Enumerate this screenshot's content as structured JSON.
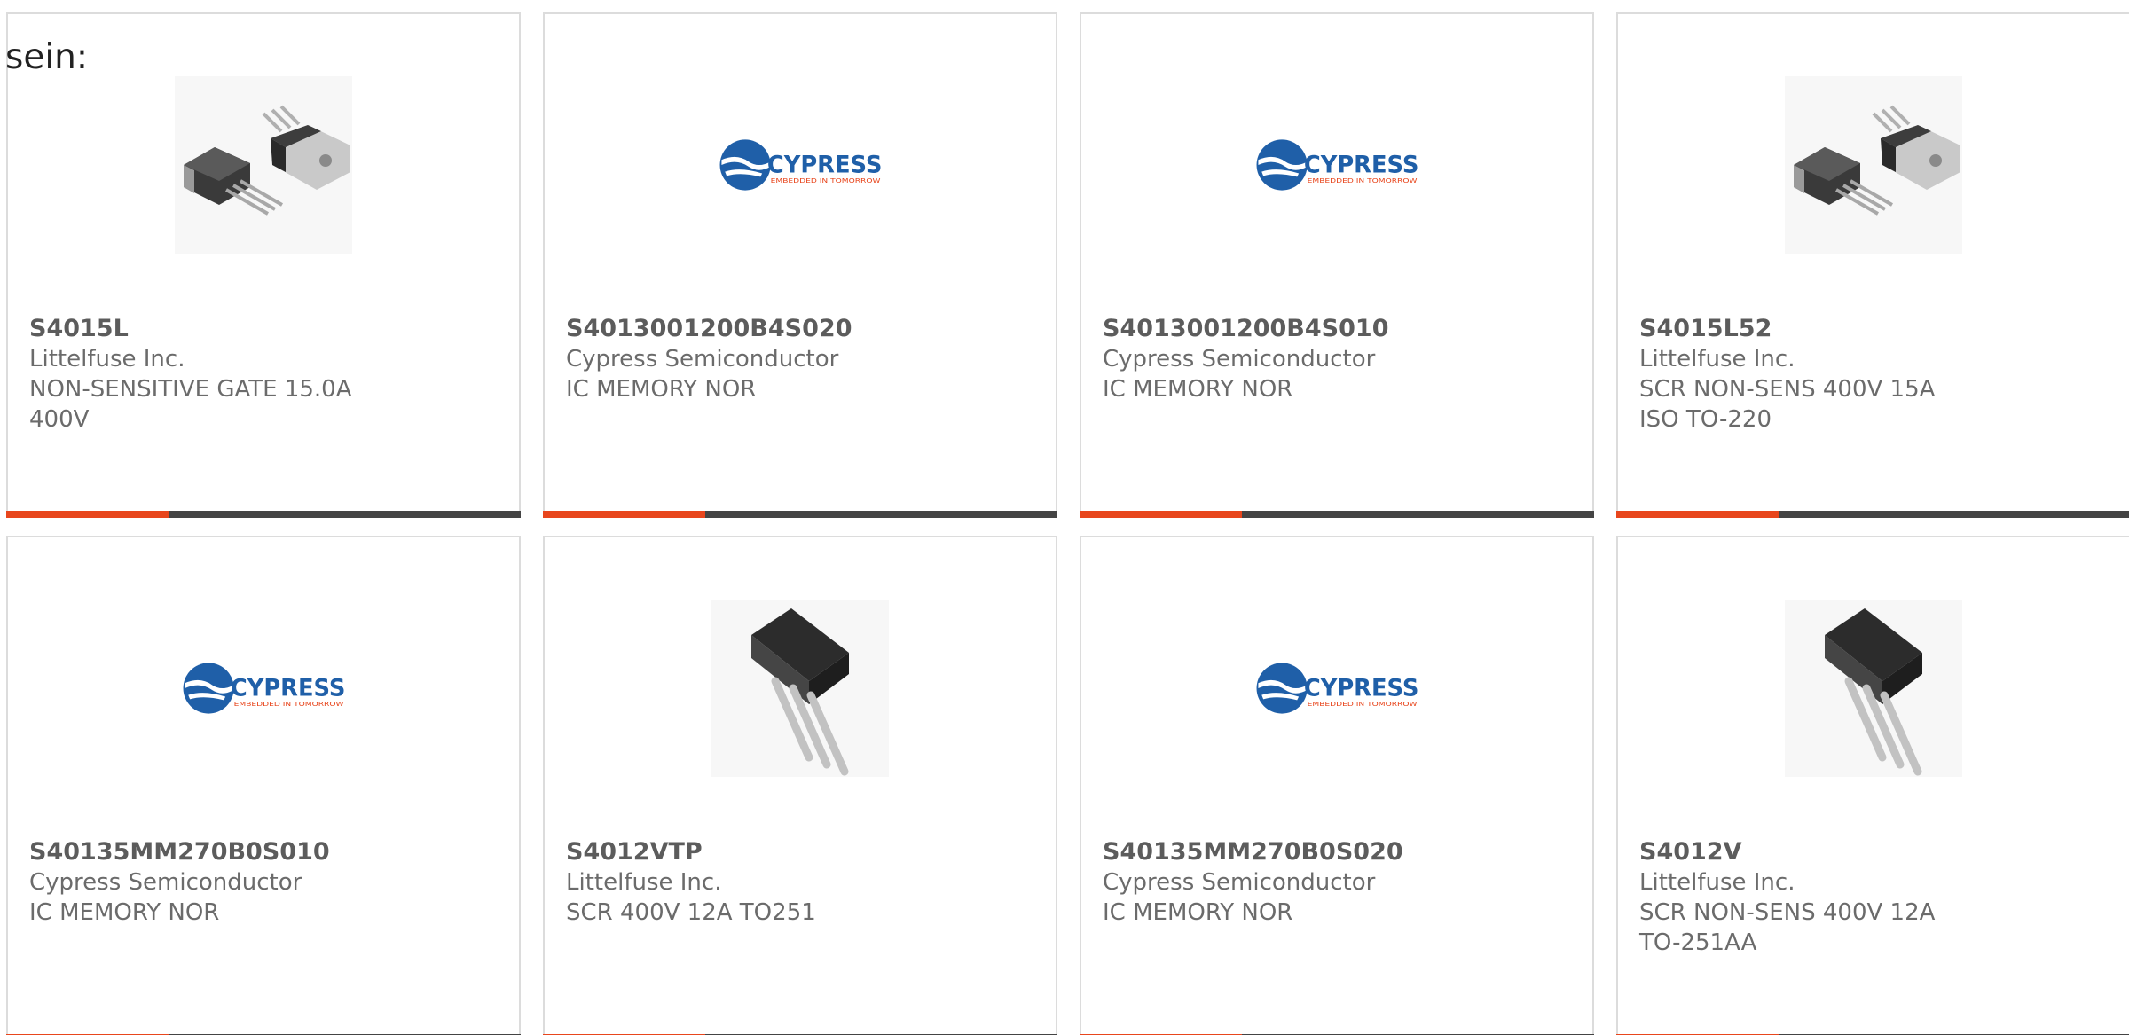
{
  "page": {
    "heading": "sein:"
  },
  "products": [
    {
      "part": "S4015L",
      "manufacturer": "Littelfuse Inc.",
      "description": "NON-SENSITIVE GATE 15.0A 400V",
      "image": "to220-pair-icon"
    },
    {
      "part": "S4013001200B4S020",
      "manufacturer": "Cypress Semiconductor",
      "description": "IC MEMORY NOR",
      "image": "cypress-logo-icon"
    },
    {
      "part": "S4013001200B4S010",
      "manufacturer": "Cypress Semiconductor",
      "description": "IC MEMORY NOR",
      "image": "cypress-logo-icon"
    },
    {
      "part": "S4015L52",
      "manufacturer": "Littelfuse Inc.",
      "description": "SCR NON-SENS 400V 15A ISO TO-220",
      "image": "to220-pair-icon"
    },
    {
      "part": "S40135MM270B0S010",
      "manufacturer": "Cypress Semiconductor",
      "description": "IC MEMORY NOR",
      "image": "cypress-logo-icon"
    },
    {
      "part": "S4012VTP",
      "manufacturer": "Littelfuse Inc.",
      "description": "SCR 400V 12A TO251",
      "image": "to251-package-icon"
    },
    {
      "part": "S40135MM270B0S020",
      "manufacturer": "Cypress Semiconductor",
      "description": "IC MEMORY NOR",
      "image": "cypress-logo-icon"
    },
    {
      "part": "S4012V",
      "manufacturer": "Littelfuse Inc.",
      "description": "SCR NON-SENS 400V 12A TO-251AA",
      "image": "to251-package-icon"
    }
  ],
  "cypress_logo": {
    "brand": "CYPRESS",
    "tagline": "EMBEDDED IN TOMORROW"
  },
  "colors": {
    "accent": "#e8461d",
    "bar": "#444444",
    "border": "#dcdcdc",
    "text": "#6b6b6b",
    "cypress_blue": "#1f5fa8"
  }
}
